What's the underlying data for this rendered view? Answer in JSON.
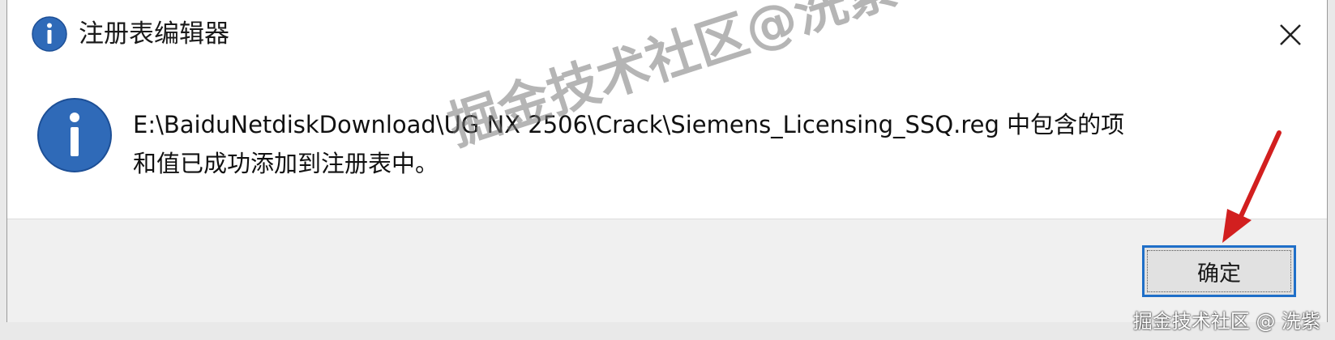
{
  "window": {
    "title": "注册表编辑器",
    "close_icon": "close-icon",
    "title_icon": "info-icon"
  },
  "message": {
    "icon": "info-icon",
    "line1": "E:\\BaiduNetdiskDownload\\UG NX 2506\\Crack\\Siemens_Licensing_SSQ.reg 中包含的项",
    "line2": "和值已成功添加到注册表中。"
  },
  "buttons": {
    "ok_label": "确定"
  },
  "watermarks": {
    "center": "掘金技术社区@洗紫",
    "corner": "掘金技术社区 @ 洗紫"
  },
  "colors": {
    "info_blue": "#2f6ab8",
    "focus_blue": "#1f6fc8",
    "annotation_red": "#d21f1f"
  }
}
